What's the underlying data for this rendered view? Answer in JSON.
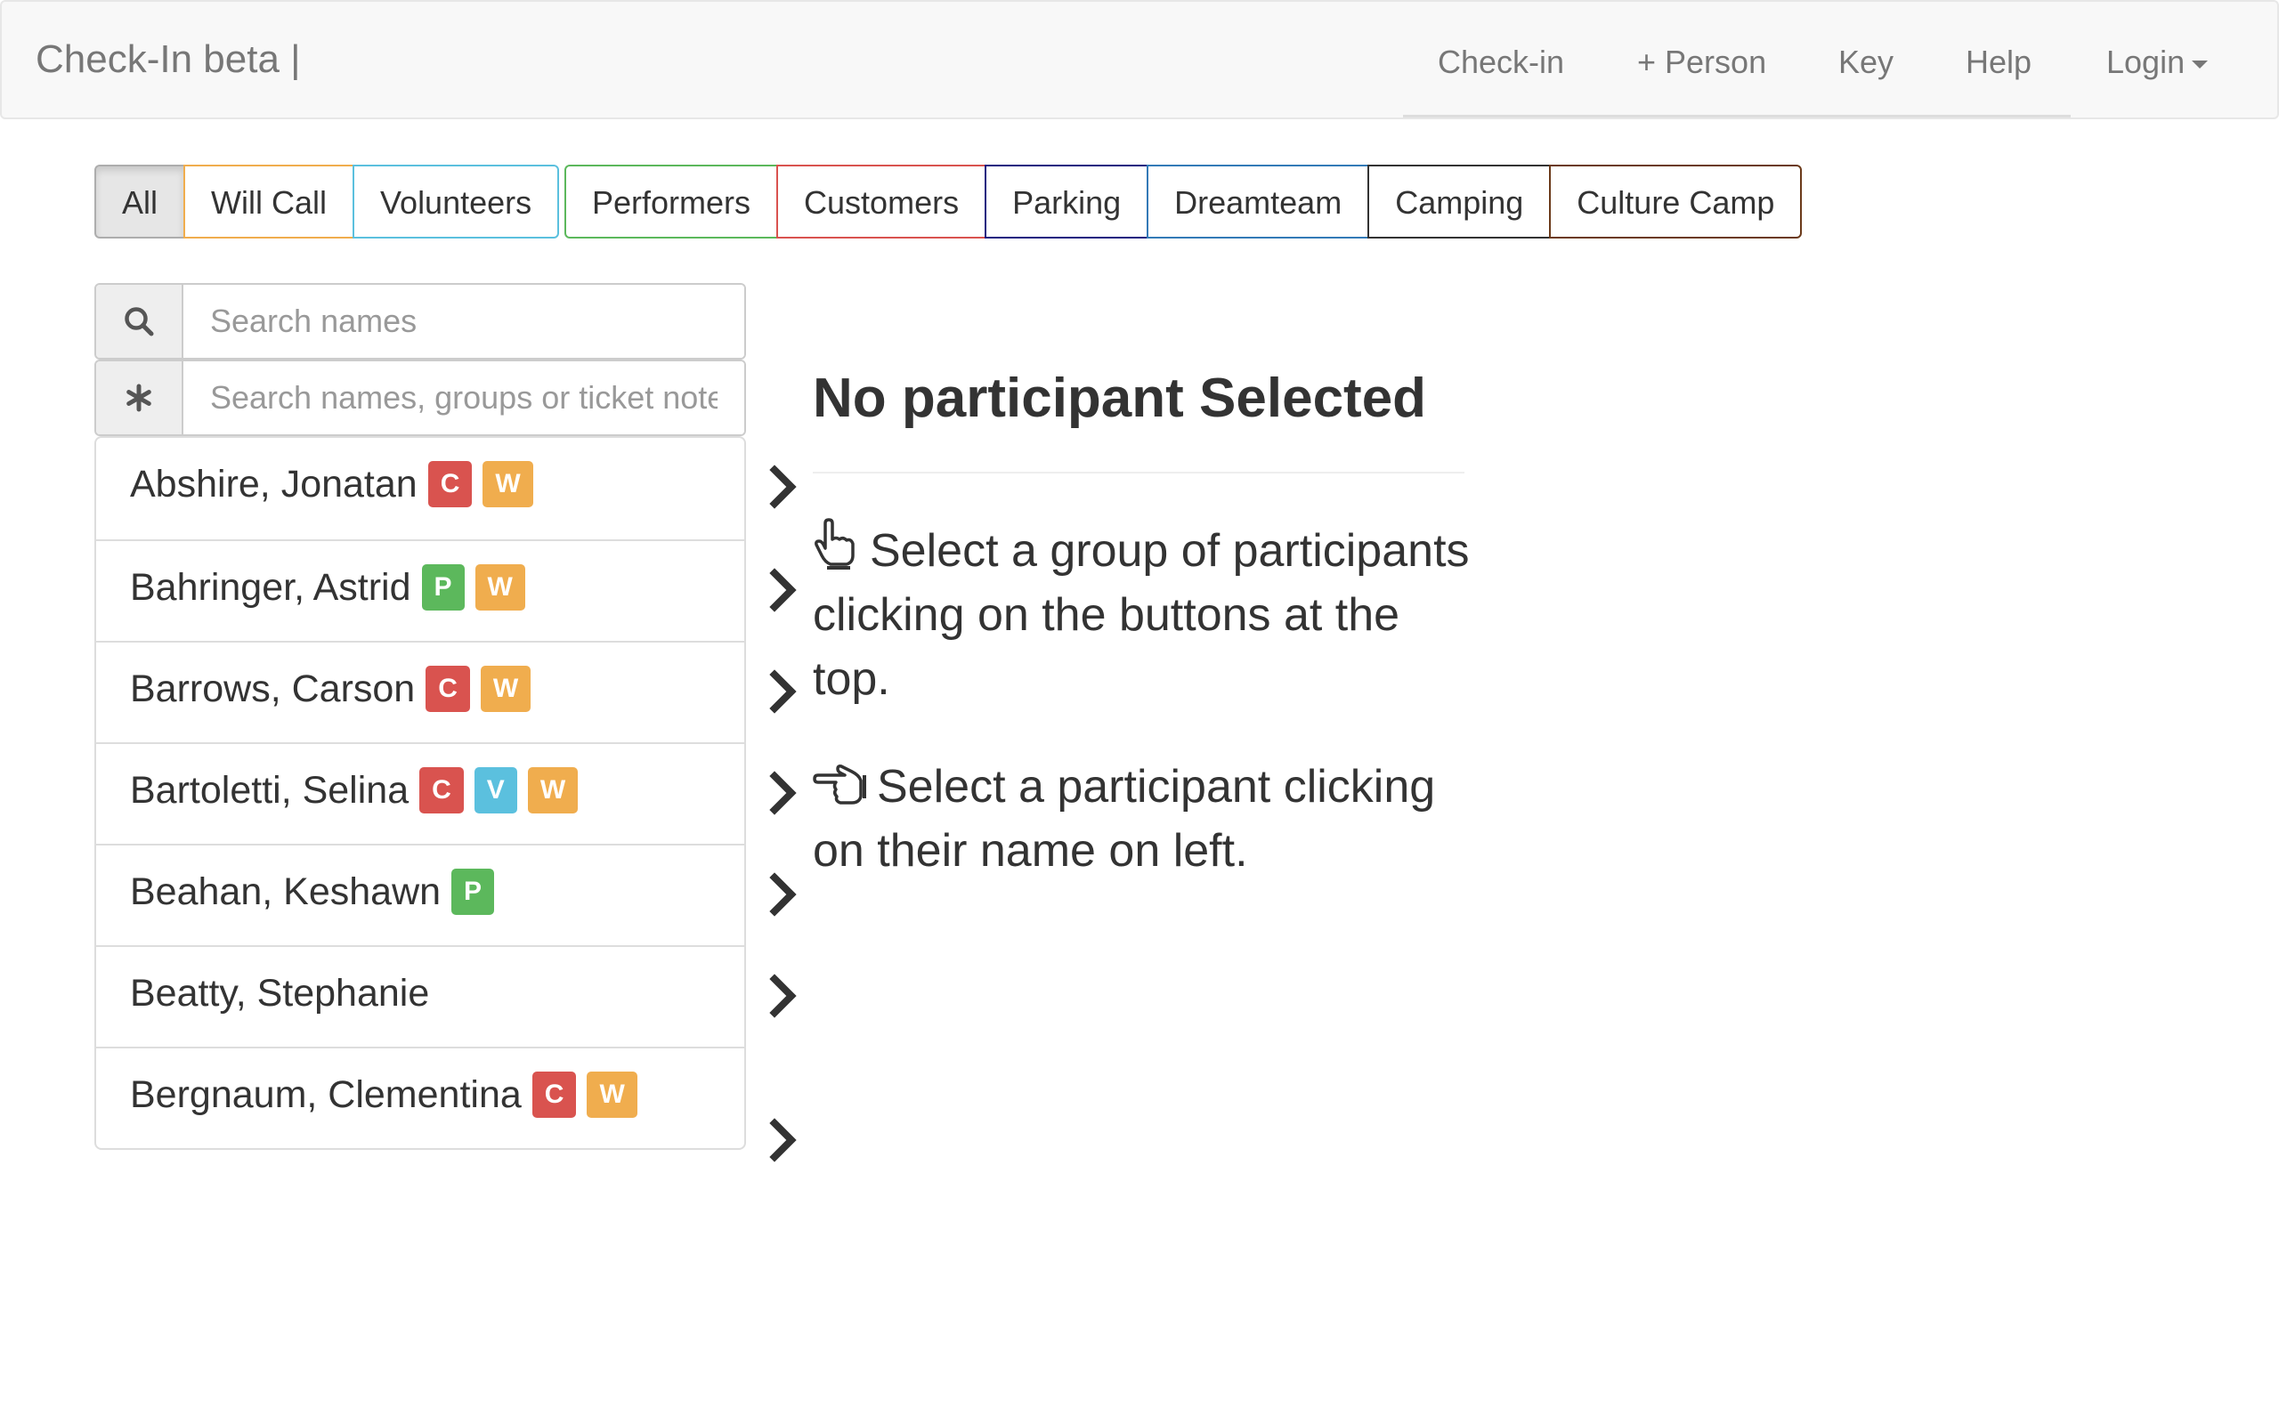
{
  "navbar": {
    "brand": "Check-In beta |",
    "links": [
      {
        "label": "Check-in"
      },
      {
        "label": "+ Person"
      },
      {
        "label": "Key"
      },
      {
        "label": "Help"
      },
      {
        "label": "Login"
      }
    ]
  },
  "filters": {
    "group1": [
      {
        "label": "All",
        "active": true
      },
      {
        "label": "Will Call",
        "color": "#f0ad4e"
      },
      {
        "label": "Volunteers",
        "color": "#5bc0de"
      }
    ],
    "group2": [
      {
        "label": "Performers",
        "color": "#5cb85c"
      },
      {
        "label": "Customers",
        "color": "#d9534f"
      },
      {
        "label": "Parking",
        "color": "#1a1a80"
      },
      {
        "label": "Dreamteam",
        "color": "#337ab7"
      },
      {
        "label": "Camping",
        "color": "#333333"
      },
      {
        "label": "Culture Camp",
        "color": "#6b3a1a"
      }
    ]
  },
  "search": {
    "names_placeholder": "Search names",
    "notes_placeholder": "Search names, groups or ticket notes"
  },
  "badge_colors": {
    "C": "#d9534f",
    "W": "#f0ad4e",
    "P": "#5cb85c",
    "V": "#5bc0de"
  },
  "participants": [
    {
      "name": "Abshire, Jonatan",
      "badges": [
        "C",
        "W"
      ]
    },
    {
      "name": "Bahringer, Astrid",
      "badges": [
        "P",
        "W"
      ]
    },
    {
      "name": "Barrows, Carson",
      "badges": [
        "C",
        "W"
      ]
    },
    {
      "name": "Bartoletti, Selina",
      "badges": [
        "C",
        "V",
        "W"
      ]
    },
    {
      "name": "Beahan, Keshawn",
      "badges": [
        "P"
      ]
    },
    {
      "name": "Beatty, Stephanie",
      "badges": []
    },
    {
      "name": "Bergnaum, Clementina",
      "badges": [
        "C",
        "W"
      ]
    }
  ],
  "panel": {
    "heading": "No participant Selected",
    "instruction_group": "Select a group of participants clicking on the buttons at the top.",
    "instruction_participant": "Select a participant clicking on their name on left."
  }
}
